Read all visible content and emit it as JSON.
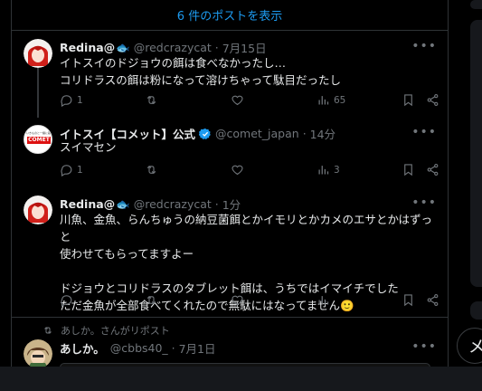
{
  "show_more": {
    "label": "6 件のポストを表示"
  },
  "posts": [
    {
      "name": "Redina@",
      "handle": "@redcrazycat",
      "time": "7月15日",
      "text": "イトスイのドジョウの餌は食べなかったし…\nコリドラスの餌は粉になって溶けちゃって駄目だったし",
      "replies": "1",
      "reposts": "",
      "likes": "",
      "views": "65"
    },
    {
      "name": "イトスイ【コメット】公式",
      "handle": "@comet_japan",
      "time": "14分",
      "avatar_text": "COMET",
      "avatar_small": "いきものと一緒に暮らそう",
      "text": "スイマセン",
      "replies": "1",
      "reposts": "",
      "likes": "",
      "views": "3"
    },
    {
      "name": "Redina@",
      "handle": "@redcrazycat",
      "time": "1分",
      "text": "川魚、金魚、らんちゅうの納豆菌餌とかイモリとかカメのエサとかはずっと\n使わせてもらってますよー\n\nドジョウとコリドラスのタブレット餌は、うちではイマイチでした\nただ金魚が全部食べてくれたので無駄にはなってません🙂",
      "replies": "",
      "reposts": "",
      "likes": "",
      "views": ""
    },
    {
      "repost_label": "あしか。さんがリポスト",
      "name": "あしか。",
      "handle": "@cbbs40_",
      "time": "7月1日"
    }
  ],
  "fab": {
    "label": "メ"
  },
  "colors": {
    "accent": "#1d9bf0",
    "muted": "#71767b",
    "border": "#2f3336"
  }
}
